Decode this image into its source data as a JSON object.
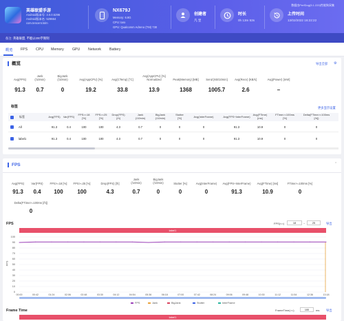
{
  "header": {
    "app_name": "英雄联盟手游",
    "app_lines": [
      "Android版本号: 3.0.0.5296",
      "Android版本名: 529664",
      "com.tencent.lolm"
    ],
    "device_name": "NX679J",
    "device_lines": [
      "Memory: 6.8G",
      "CPU: taro",
      "GPU: Qualcomm Adreno (TM) 730"
    ],
    "creator_label": "创建者",
    "creator_value": "凡 皇",
    "duration_label": "时长",
    "duration_value": "0h 13m 53s",
    "upload_label": "上传时间",
    "upload_value": "13/02/2022 16:22:22",
    "top_note": "数据由PerfDog(5.1.220)性能狗采集"
  },
  "strip": {
    "label": "备注:",
    "text": "英雄联盟, 不能以200字限制"
  },
  "tabs": [
    "概览",
    "FPS",
    "CPU",
    "Memory",
    "GPU",
    "Network",
    "Battery"
  ],
  "overview": {
    "title": "概览",
    "export_label": "导出全部",
    "metrics": [
      {
        "label": "Avg(FPS)",
        "value": "91.3"
      },
      {
        "label": "Jank\n(/10min)",
        "value": "0.7"
      },
      {
        "label": "BigJank\n(/10min)",
        "value": "0"
      },
      {
        "label": "Avg(AppCPU) [%]",
        "value": "19.2"
      },
      {
        "label": "Avg(CTemp) [°C]",
        "value": "33.8"
      },
      {
        "label": "Avg(AppCPU) [%]\nNormalized",
        "value": "13.9"
      },
      {
        "label": "Peak(Memory) [MB]",
        "value": "1368"
      },
      {
        "label": "Send [KB/10min]",
        "value": "1005.7"
      },
      {
        "label": "Avg(Recv) [KB/s]",
        "value": "2.6"
      },
      {
        "label": "Avg(Power) [mW]",
        "value": "–"
      }
    ]
  },
  "labels_table": {
    "title": "标签",
    "more_link": "更多显示设置",
    "headers": [
      "标签",
      "Avg(FPS)",
      "Var(FPS)",
      "FPS>=18\n[%]",
      "FPS>=25\n[%]",
      "Drop(FPS)\n[/h]",
      "Jank\n(/10min)",
      "BigJank\n(/10min)",
      "Stutter\n[%]",
      "Avg(InterFrame)",
      "Avg(FPS+InterFrame)",
      "Avg(FTime)\n[ms]",
      "FTime>=100ms\n[%]",
      "Delta(FTime>=100ms\n[/h])"
    ],
    "rows": [
      {
        "label": "All",
        "cells": [
          "91.3",
          "0.4",
          "100",
          "100",
          "4.3",
          "0.7",
          "0",
          "0",
          "0",
          "91.3",
          "10.9",
          "0",
          "0"
        ]
      },
      {
        "label": "label1",
        "cells": [
          "91.3",
          "0.4",
          "100",
          "100",
          "4.3",
          "0.7",
          "0",
          "0",
          "0",
          "91.3",
          "10.9",
          "0",
          "0"
        ]
      }
    ]
  },
  "fps_section": {
    "title": "FPS",
    "metrics": [
      {
        "label": "Avg(FPS)",
        "value": "91.3"
      },
      {
        "label": "Var(FPS)",
        "value": "0.4"
      },
      {
        "label": "FPS>=18 [%]",
        "value": "100"
      },
      {
        "label": "FPS>=25 [%]",
        "value": "100"
      },
      {
        "label": "Drop(FPS) [/h]",
        "value": "4.3"
      },
      {
        "label": "Jank\n(/10min)",
        "value": "0.7"
      },
      {
        "label": "BigJank\n(/10min)",
        "value": "0"
      },
      {
        "label": "Stutter [%]",
        "value": "0"
      },
      {
        "label": "Avg(InterFrame)",
        "value": "0"
      },
      {
        "label": "Avg(FPS+InterFrame)",
        "value": "91.3"
      },
      {
        "label": "Avg(FTime) [ms]",
        "value": "10.9"
      },
      {
        "label": "FTime>=100ms [%]",
        "value": "0"
      }
    ],
    "delta_label": "Delta(FTime>=100ms [/h])",
    "delta_value": "0"
  },
  "fps_chart_controls": {
    "title": "FPS",
    "range_label": "FPS(<=)",
    "range_low": "18",
    "range_high": "25",
    "export": "导出",
    "bar_label": "label1"
  },
  "frametime_chart_controls": {
    "title": "Frame Time",
    "range_label": "FrameTime(>=)",
    "range_value": "100",
    "unit": "ms",
    "export": "导出",
    "bar_label": "label1"
  },
  "chart_data": {
    "type": "line",
    "title": "FPS",
    "xlabel": "",
    "ylabel": "FPS",
    "ylim": [
      0,
      100
    ],
    "yticks": [
      0,
      10,
      20,
      30,
      40,
      50,
      60,
      70,
      80,
      90,
      100
    ],
    "x": [
      "00:00",
      "00:42",
      "01:24",
      "02:06",
      "02:48",
      "03:30",
      "04:12",
      "04:54",
      "05:36",
      "06:18",
      "07:00",
      "07:42",
      "08:24",
      "09:06",
      "09:48",
      "10:30",
      "11:12",
      "11:54",
      "12:36",
      "13:18"
    ],
    "series": [
      {
        "name": "FPS",
        "color": "#9b3fb8",
        "values": [
          90,
          91,
          91,
          91,
          91,
          91,
          91,
          91,
          90,
          91,
          91,
          91,
          91,
          91,
          91,
          91,
          91,
          91,
          91,
          91
        ]
      },
      {
        "name": "Jank",
        "color": "#e8a23c",
        "values": []
      },
      {
        "name": "BigJank",
        "color": "#d9435e",
        "values": []
      },
      {
        "name": "Stutter",
        "color": "#3c63e6",
        "values": []
      },
      {
        "name": "InterFrame",
        "color": "#2bb5a0",
        "values": []
      }
    ],
    "legend": "bottom",
    "grid": true
  }
}
